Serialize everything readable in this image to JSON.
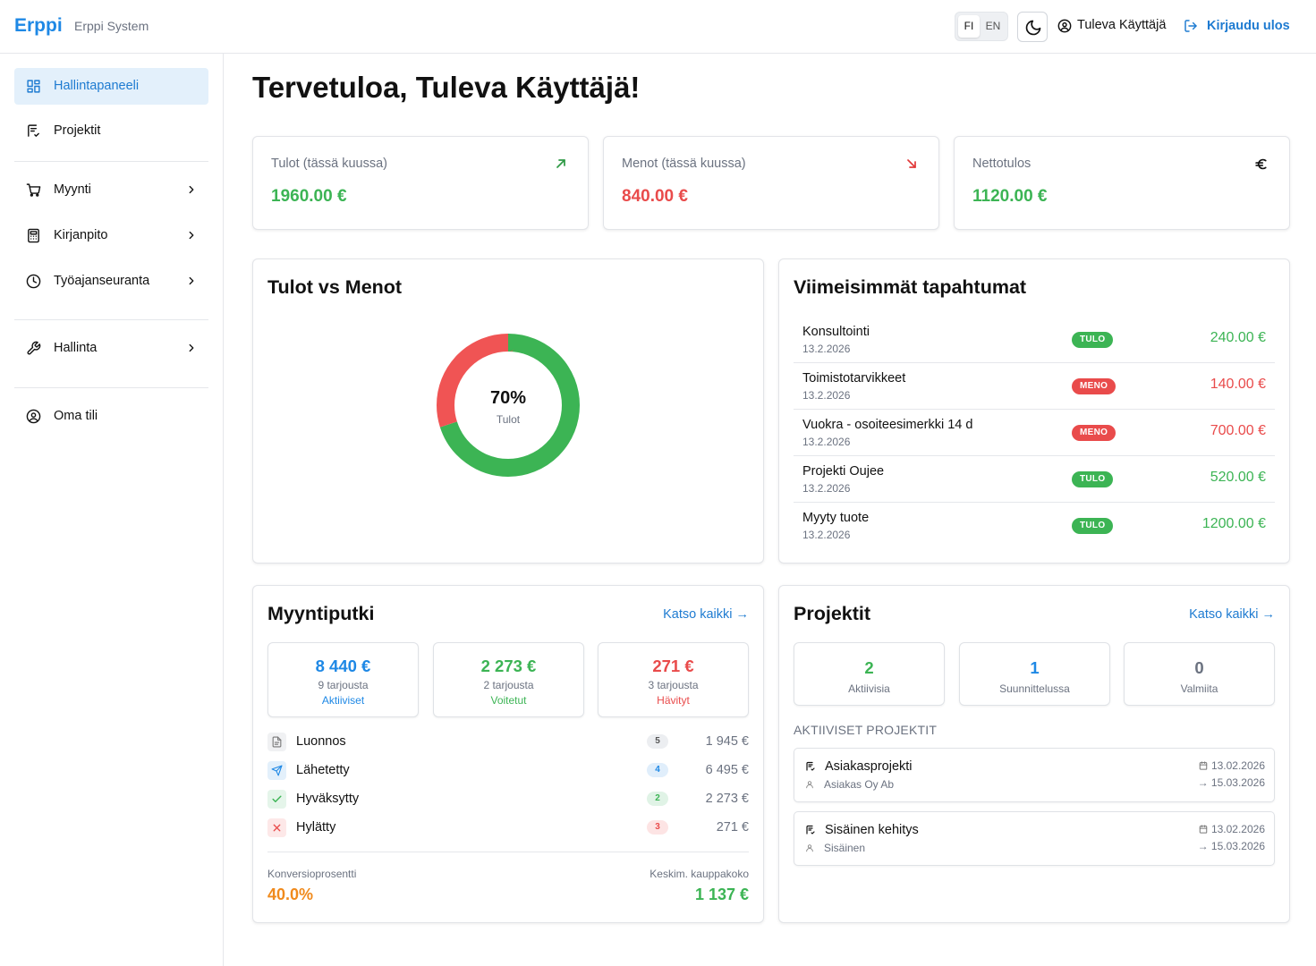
{
  "header": {
    "brand": "Erppi",
    "brand_sub": "Erppi System",
    "lang_fi": "FI",
    "lang_en": "EN",
    "user_name": "Tuleva Käyttäjä",
    "logout_label": "Kirjaudu ulos"
  },
  "sidebar": {
    "items": [
      {
        "label": "Hallintapaneeli",
        "icon": "dashboard-icon",
        "active": true
      },
      {
        "label": "Projektit",
        "icon": "project-icon"
      },
      {
        "label": "Myynti",
        "icon": "cart-icon",
        "expandable": true
      },
      {
        "label": "Kirjanpito",
        "icon": "calculator-icon",
        "expandable": true
      },
      {
        "label": "Työajanseuranta",
        "icon": "clock-icon",
        "expandable": true
      },
      {
        "label": "Hallinta",
        "icon": "wrench-icon",
        "expandable": true
      },
      {
        "label": "Oma tili",
        "icon": "user-circle-icon"
      }
    ]
  },
  "main": {
    "welcome": "Tervetuloa, Tuleva Käyttäjä!",
    "stats": [
      {
        "label": "Tulot (tässä kuussa)",
        "value": "1960.00 €",
        "icon": "arrow-up-right-icon"
      },
      {
        "label": "Menot (tässä kuussa)",
        "value": "840.00 €",
        "icon": "arrow-down-right-icon"
      },
      {
        "label": "Nettotulos",
        "value": "1120.00 €",
        "icon": "euro-icon"
      }
    ]
  },
  "chart_data": {
    "type": "pie",
    "title": "Tulot vs Menot",
    "categories": [
      "Tulot",
      "Menot"
    ],
    "values": [
      1960,
      840
    ],
    "center_value": "70%",
    "center_label": "Tulot",
    "colors": [
      "#3cb454",
      "#f05454"
    ]
  },
  "transactions": {
    "title": "Viimeisimmät tapahtumat",
    "items": [
      {
        "name": "Konsultointi",
        "date": "13.2.2026",
        "type": "TULO",
        "amount": "240.00 €"
      },
      {
        "name": "Toimistotarvikkeet",
        "date": "13.2.2026",
        "type": "MENO",
        "amount": "140.00 €"
      },
      {
        "name": "Vuokra - osoiteesimerkki 14 d",
        "date": "13.2.2026",
        "type": "MENO",
        "amount": "700.00 €"
      },
      {
        "name": "Projekti Oujee",
        "date": "13.2.2026",
        "type": "TULO",
        "amount": "520.00 €"
      },
      {
        "name": "Myyty tuote",
        "date": "13.2.2026",
        "type": "TULO",
        "amount": "1200.00 €"
      }
    ]
  },
  "pipeline": {
    "title": "Myyntiputki",
    "see_all": "Katso kaikki →",
    "summary": [
      {
        "value": "8 440 €",
        "sub": "9 tarjousta",
        "tag": "Aktiiviset"
      },
      {
        "value": "2 273 €",
        "sub": "2 tarjousta",
        "tag": "Voitetut"
      },
      {
        "value": "271 €",
        "sub": "3 tarjousta",
        "tag": "Hävityt"
      }
    ],
    "stages": [
      {
        "name": "Luonnos",
        "count": "5",
        "amount": "1 945 €"
      },
      {
        "name": "Lähetetty",
        "count": "4",
        "amount": "6 495 €"
      },
      {
        "name": "Hyväksytty",
        "count": "2",
        "amount": "2 273 €"
      },
      {
        "name": "Hylätty",
        "count": "3",
        "amount": "271 €"
      }
    ],
    "conversion_label": "Konversioprosentti",
    "conversion_value": "40.0%",
    "avg_label": "Keskim. kauppakoko",
    "avg_value": "1 137 €"
  },
  "projects": {
    "title": "Projektit",
    "see_all": "Katso kaikki →",
    "summary": [
      {
        "value": "2",
        "label": "Aktiivisia"
      },
      {
        "value": "1",
        "label": "Suunnittelussa"
      },
      {
        "value": "0",
        "label": "Valmiita"
      }
    ],
    "section_label": "AKTIIVISET PROJEKTIT",
    "items": [
      {
        "name": "Asiakasprojekti",
        "client": "Asiakas Oy Ab",
        "start": "13.02.2026",
        "end": "→ 15.03.2026"
      },
      {
        "name": "Sisäinen kehitys",
        "client": "Sisäinen",
        "start": "13.02.2026",
        "end": "→ 15.03.2026"
      }
    ]
  }
}
